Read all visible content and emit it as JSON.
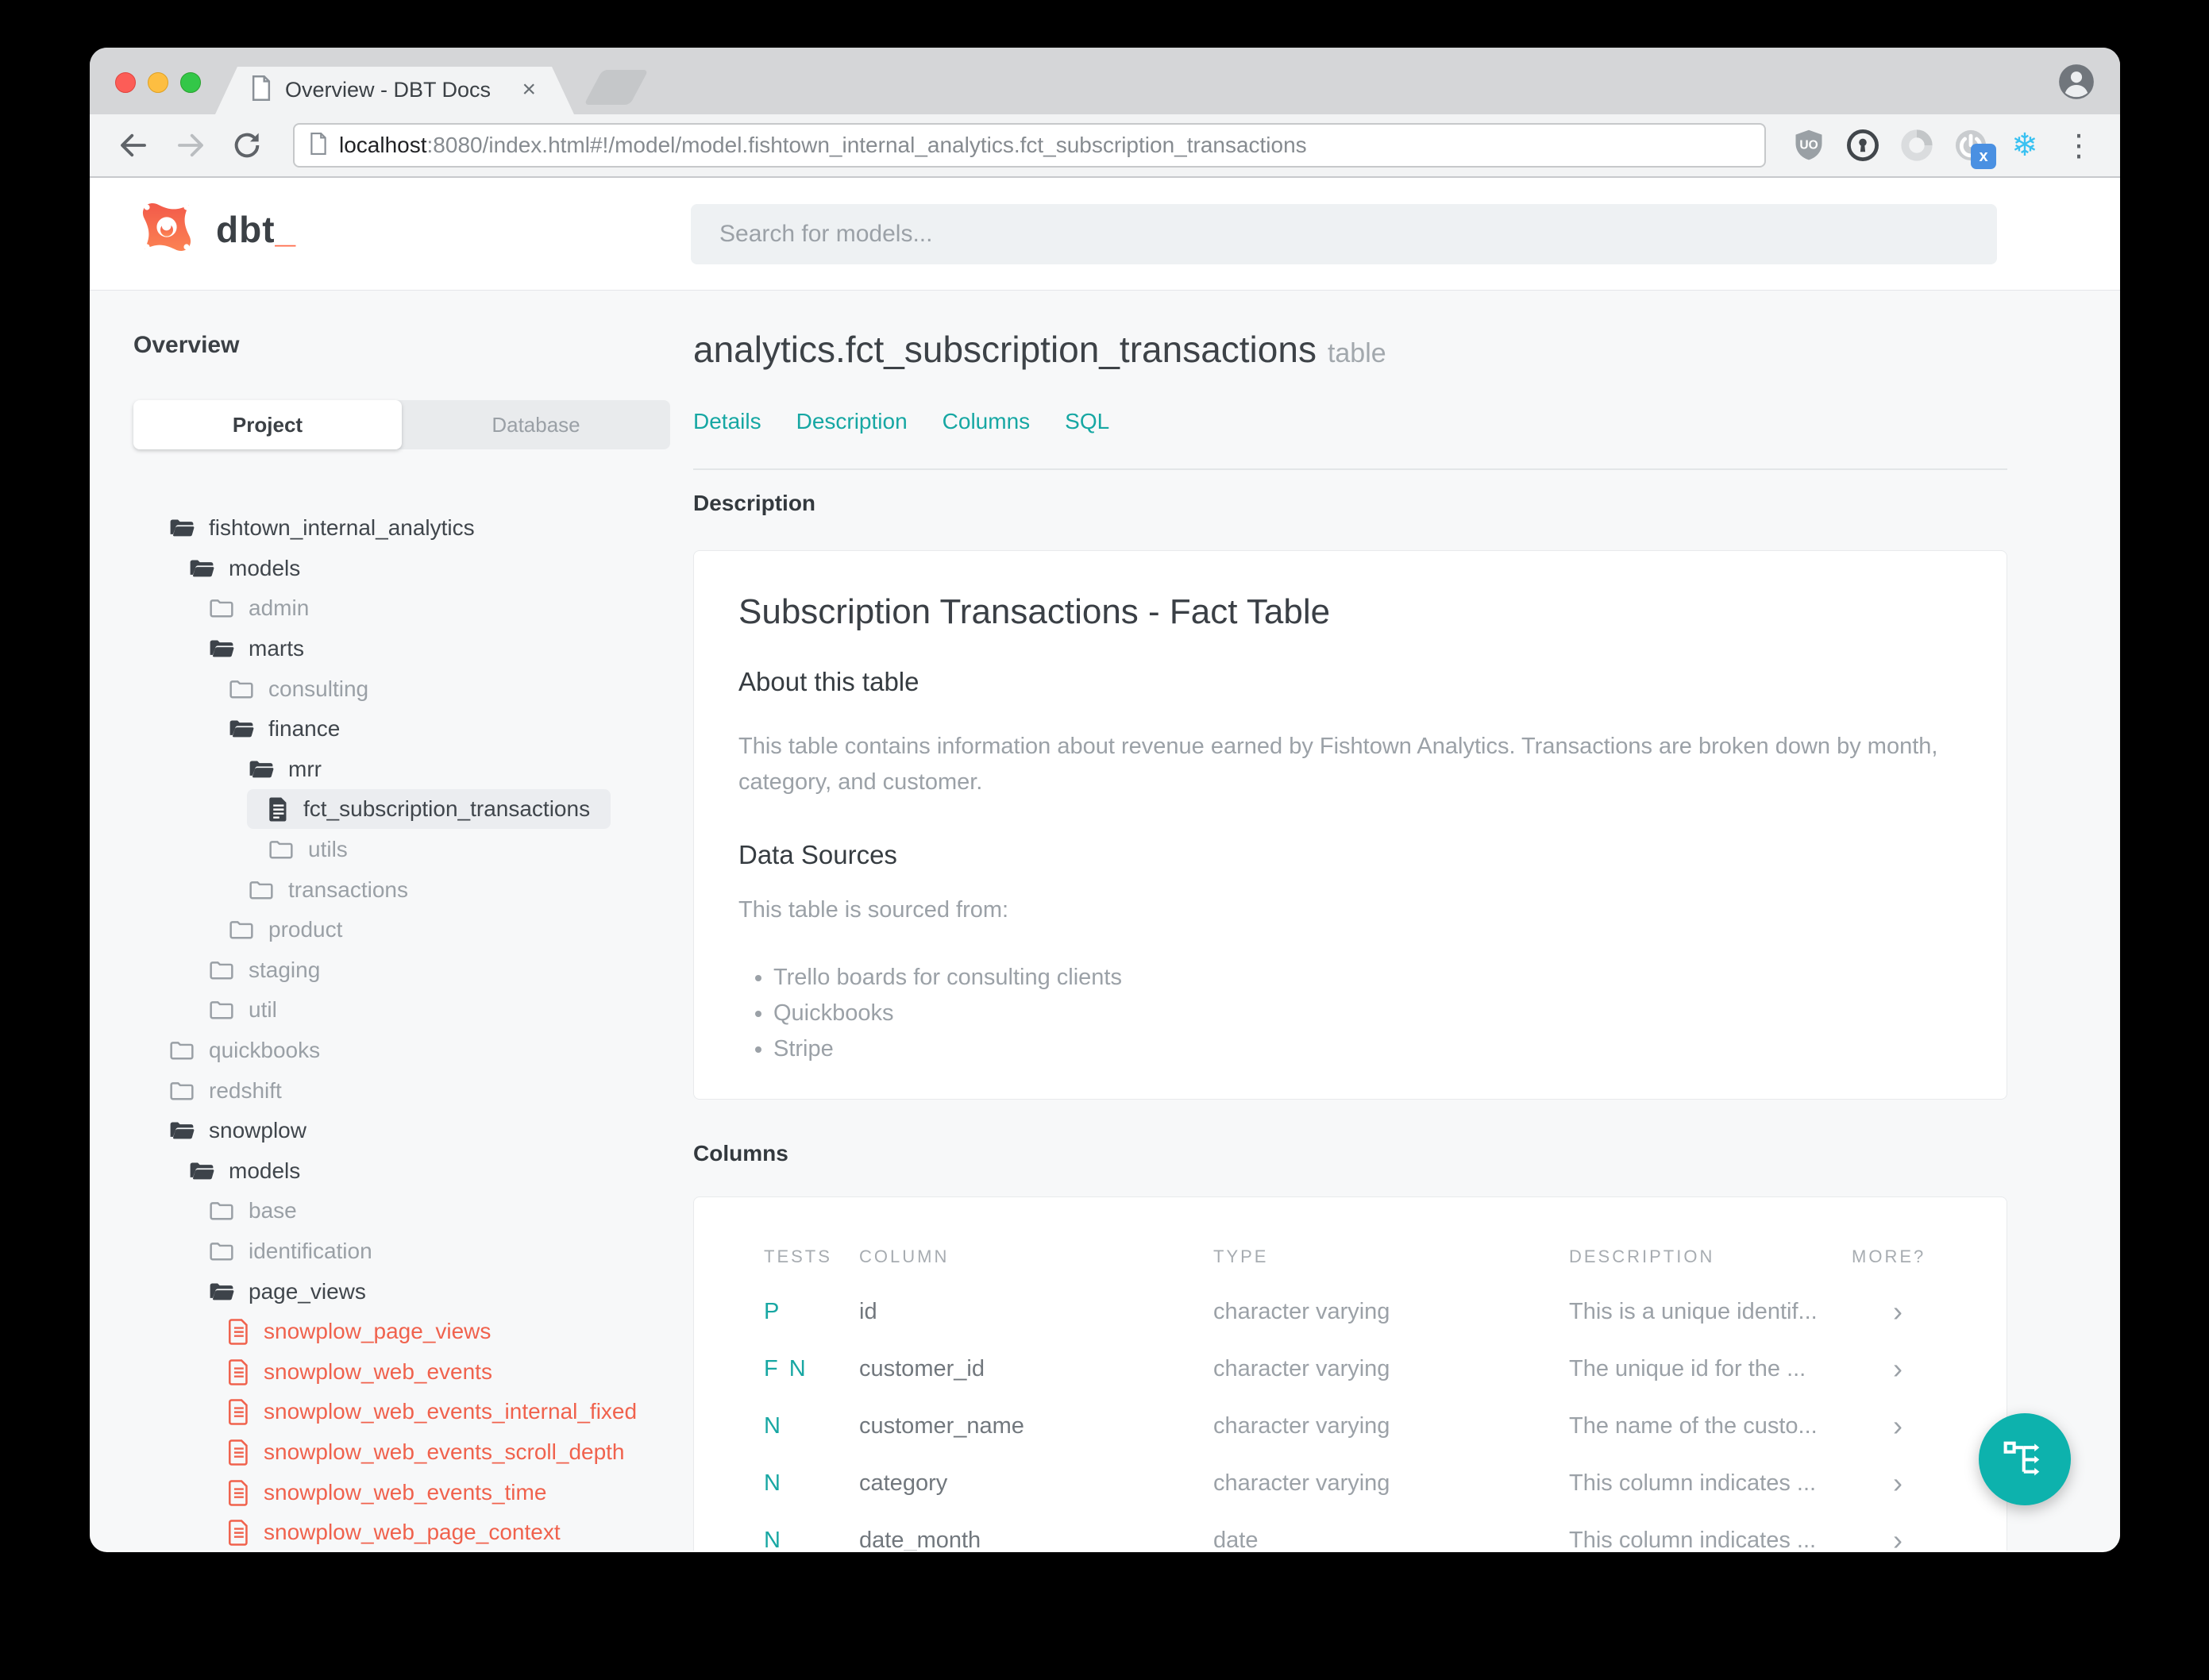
{
  "browser": {
    "tab_title": "Overview - DBT Docs",
    "url_host": "localhost",
    "url_rest": ":8080/index.html#!/model/model.fishtown_internal_analytics.fct_subscription_transactions",
    "extension_icons": [
      "ublock-icon",
      "onepassword-icon",
      "ring-icon",
      "power-x-icon",
      "snowflake-icon",
      "overflow-menu-icon"
    ],
    "badge_x": "x"
  },
  "icons": {
    "close_tab": "×",
    "snowflake": "❄",
    "menu_dots": "⋮",
    "chevron": "›"
  },
  "colors": {
    "accent_teal": "#16a7a3",
    "fab_teal": "#0db2ad",
    "brand_orange": "#ff6b4a",
    "model_red": "#f0624d",
    "tree_dark": "#40464c",
    "tree_gray": "#9aa0a6"
  },
  "header": {
    "brand": "dbt",
    "brand_cursor": "_",
    "search_placeholder": "Search for models..."
  },
  "sidebar": {
    "title": "Overview",
    "tabs": [
      "Project",
      "Database"
    ],
    "active_tab": "Project",
    "tree": [
      {
        "label": "fishtown_internal_analytics",
        "level": 0,
        "icon": "folder-open",
        "tone": "dark"
      },
      {
        "label": "models",
        "level": 1,
        "icon": "folder-open",
        "tone": "dark"
      },
      {
        "label": "admin",
        "level": 2,
        "icon": "folder-closed",
        "tone": "gray"
      },
      {
        "label": "marts",
        "level": 2,
        "icon": "folder-open",
        "tone": "dark"
      },
      {
        "label": "consulting",
        "level": 3,
        "icon": "folder-closed",
        "tone": "gray"
      },
      {
        "label": "finance",
        "level": 3,
        "icon": "folder-open",
        "tone": "dark"
      },
      {
        "label": "mrr",
        "level": 4,
        "icon": "folder-open",
        "tone": "dark"
      },
      {
        "label": "fct_subscription_transactions",
        "level": 5,
        "icon": "file",
        "tone": "dark",
        "selected": true
      },
      {
        "label": "utils",
        "level": 5,
        "icon": "folder-closed",
        "tone": "gray"
      },
      {
        "label": "transactions",
        "level": 4,
        "icon": "folder-closed",
        "tone": "gray"
      },
      {
        "label": "product",
        "level": 3,
        "icon": "folder-closed",
        "tone": "gray"
      },
      {
        "label": "staging",
        "level": 2,
        "icon": "folder-closed",
        "tone": "gray"
      },
      {
        "label": "util",
        "level": 2,
        "icon": "folder-closed",
        "tone": "gray"
      },
      {
        "label": "quickbooks",
        "level": 0,
        "icon": "folder-closed",
        "tone": "gray"
      },
      {
        "label": "redshift",
        "level": 0,
        "icon": "folder-closed",
        "tone": "gray"
      },
      {
        "label": "snowplow",
        "level": 0,
        "icon": "folder-open",
        "tone": "dark"
      },
      {
        "label": "models",
        "level": 1,
        "icon": "folder-open",
        "tone": "dark"
      },
      {
        "label": "base",
        "level": 2,
        "icon": "folder-closed",
        "tone": "gray"
      },
      {
        "label": "identification",
        "level": 2,
        "icon": "folder-closed",
        "tone": "gray"
      },
      {
        "label": "page_views",
        "level": 2,
        "icon": "folder-open",
        "tone": "dark"
      },
      {
        "label": "snowplow_page_views",
        "level": 3,
        "icon": "file",
        "tone": "red"
      },
      {
        "label": "snowplow_web_events",
        "level": 3,
        "icon": "file",
        "tone": "red"
      },
      {
        "label": "snowplow_web_events_internal_fixed",
        "level": 3,
        "icon": "file",
        "tone": "red"
      },
      {
        "label": "snowplow_web_events_scroll_depth",
        "level": 3,
        "icon": "file",
        "tone": "red"
      },
      {
        "label": "snowplow_web_events_time",
        "level": 3,
        "icon": "file",
        "tone": "red"
      },
      {
        "label": "snowplow_web_page_context",
        "level": 3,
        "icon": "file",
        "tone": "red"
      }
    ]
  },
  "main": {
    "title": "analytics.fct_subscription_transactions",
    "title_badge": "table",
    "nav": [
      "Details",
      "Description",
      "Columns",
      "SQL"
    ],
    "description_section": {
      "header": "Description",
      "card": {
        "title": "Subscription Transactions - Fact Table",
        "about_heading": "About this table",
        "about_text": "This table contains information about revenue earned by Fishtown Analytics. Transactions are broken down by month, category, and customer.",
        "sources_heading": "Data Sources",
        "sources_intro": "This table is sourced from:",
        "sources": [
          "Trello boards for consulting clients",
          "Quickbooks",
          "Stripe"
        ]
      }
    },
    "columns_section": {
      "header": "Columns",
      "table": {
        "headers": [
          "TESTS",
          "COLUMN",
          "TYPE",
          "DESCRIPTION",
          "MORE?"
        ],
        "rows": [
          {
            "tests": "P",
            "column": "id",
            "type": "character varying",
            "description": "This is a unique identif..."
          },
          {
            "tests": "F N",
            "column": "customer_id",
            "type": "character varying",
            "description": "The unique id for the ..."
          },
          {
            "tests": "N",
            "column": "customer_name",
            "type": "character varying",
            "description": "The name of the custo..."
          },
          {
            "tests": "N",
            "column": "category",
            "type": "character varying",
            "description": "This column indicates ..."
          },
          {
            "tests": "N",
            "column": "date_month",
            "type": "date",
            "description": "This column indicates ..."
          }
        ]
      }
    }
  }
}
